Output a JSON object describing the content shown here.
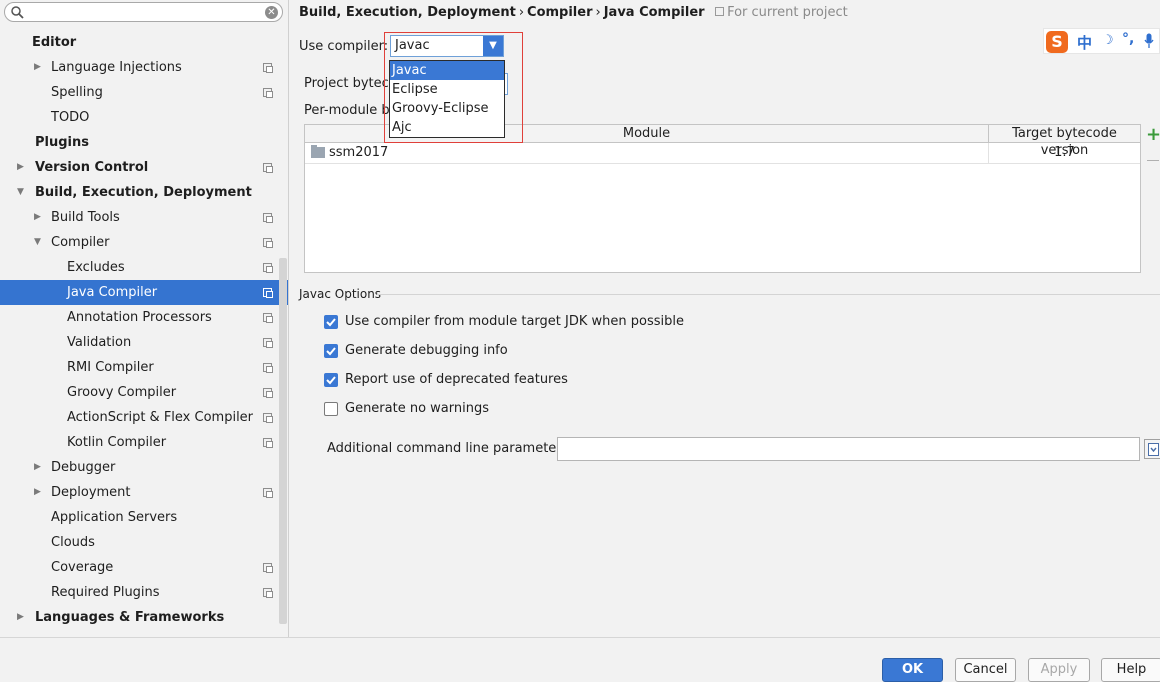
{
  "sidebar": {
    "search": {
      "value": "",
      "placeholder": ""
    },
    "items": [
      {
        "label": "Editor"
      },
      {
        "label": "Language Injections"
      },
      {
        "label": "Spelling"
      },
      {
        "label": "TODO"
      },
      {
        "label": "Plugins"
      },
      {
        "label": "Version Control"
      },
      {
        "label": "Build, Execution, Deployment"
      },
      {
        "label": "Build Tools"
      },
      {
        "label": "Compiler"
      },
      {
        "label": "Excludes"
      },
      {
        "label": "Java Compiler"
      },
      {
        "label": "Annotation Processors"
      },
      {
        "label": "Validation"
      },
      {
        "label": "RMI Compiler"
      },
      {
        "label": "Groovy Compiler"
      },
      {
        "label": "ActionScript & Flex Compiler"
      },
      {
        "label": "Kotlin Compiler"
      },
      {
        "label": "Debugger"
      },
      {
        "label": "Deployment"
      },
      {
        "label": "Application Servers"
      },
      {
        "label": "Clouds"
      },
      {
        "label": "Coverage"
      },
      {
        "label": "Required Plugins"
      },
      {
        "label": "Languages & Frameworks"
      }
    ]
  },
  "breadcrumb": {
    "parts": [
      "Build, Execution, Deployment",
      "Compiler",
      "Java Compiler"
    ],
    "separator": "›",
    "scope": "For current project"
  },
  "compiler": {
    "label": "Use compiler:",
    "selected": "Javac",
    "options": [
      "Javac",
      "Eclipse",
      "Groovy-Eclipse",
      "Ajc"
    ]
  },
  "bytecode": {
    "label": "Project bytecode version:"
  },
  "per_module": {
    "label": "Per-module bytecode version:"
  },
  "module_table": {
    "columns": [
      "Module",
      "Target bytecode version"
    ],
    "rows": [
      {
        "module": "ssm2017",
        "version": "1.7"
      }
    ]
  },
  "javac_options": {
    "title": "Javac Options",
    "checkboxes": [
      {
        "label": "Use compiler from module target JDK when possible",
        "checked": true
      },
      {
        "label": "Generate debugging info",
        "checked": true
      },
      {
        "label": "Report use of deprecated features",
        "checked": true
      },
      {
        "label": "Generate no warnings",
        "checked": false
      }
    ],
    "params_label": "Additional command line parameters:",
    "params_value": ""
  },
  "ime": {
    "logo": "S",
    "mode": "中",
    "moon": "☽",
    "punct": "°,"
  },
  "footer": {
    "ok": "OK",
    "cancel": "Cancel",
    "apply": "Apply",
    "help": "Help"
  },
  "colors": {
    "accent": "#3574d0",
    "highlight": "#e0403a",
    "add": "#3b9a3b"
  }
}
